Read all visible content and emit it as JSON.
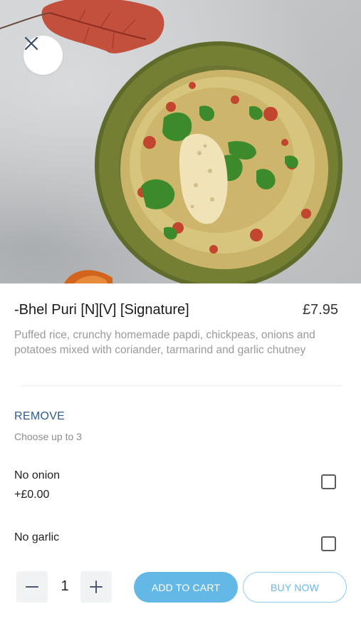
{
  "item": {
    "title": "-Bhel Puri [N][V] [Signature]",
    "price": "£7.95",
    "description": "Puffed rice, crunchy homemade papdi, chickpeas, onions and potatoes mixed with coriander, tarmarind and garlic chutney"
  },
  "hero": {
    "image_icon": "bhel-puri-dish-photo"
  },
  "remove_section": {
    "title": "REMOVE",
    "subtitle": "Choose up to 3",
    "options": [
      {
        "name": "No onion",
        "price": "+£0.00",
        "checked": false
      },
      {
        "name": "No garlic",
        "checked": false
      }
    ]
  },
  "cart": {
    "quantity": "1",
    "add_to_cart_label": "ADD TO CART",
    "buy_now_label": "BUY NOW"
  },
  "colors": {
    "accent": "#64b8e6",
    "section_title": "#2f5d8c"
  }
}
